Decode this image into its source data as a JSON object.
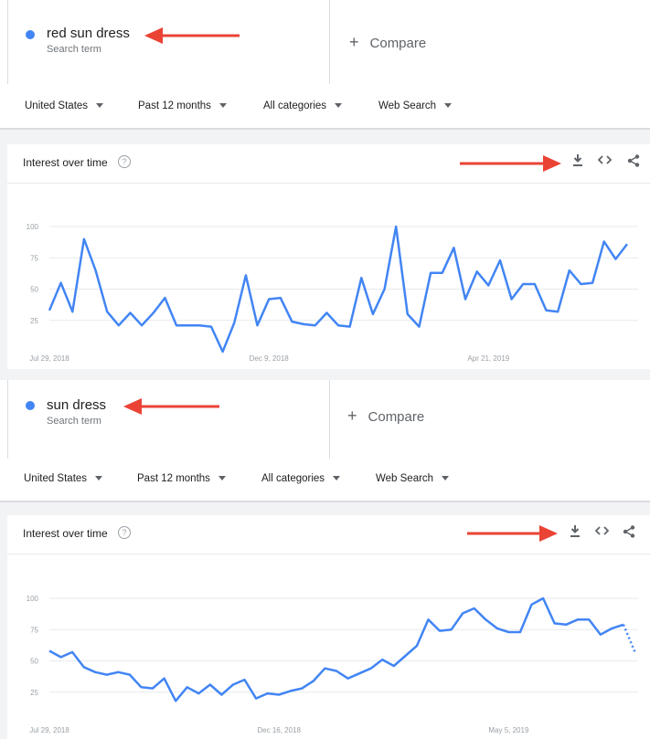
{
  "panels": [
    {
      "term": {
        "name": "red sun dress",
        "sub": "Search term"
      },
      "compare_label": "Compare",
      "filters": [
        "United States",
        "Past 12 months",
        "All categories",
        "Web Search"
      ],
      "card_title": "Interest over time",
      "help_glyph": "?",
      "icons": [
        "download-icon",
        "embed-icon",
        "share-icon"
      ],
      "chart_data": {
        "type": "line",
        "title": "Interest over time",
        "y_ticks": [
          25,
          50,
          75,
          100
        ],
        "ylim": [
          0,
          100
        ],
        "x_tick_labels": [
          "Jul 29, 2018",
          "Dec 9, 2018",
          "Apr 21, 2019"
        ],
        "x_tick_index": [
          0,
          19,
          38
        ],
        "series": [
          {
            "values": [
              33,
              55,
              32,
              90,
              65,
              32,
              21,
              31,
              21,
              31,
              43,
              21,
              21,
              21,
              20,
              0,
              23,
              61,
              21,
              42,
              43,
              24,
              22,
              21,
              31,
              21,
              20,
              59,
              30,
              50,
              100,
              30,
              20,
              63,
              63,
              83,
              42,
              64,
              53,
              73,
              42,
              54,
              54,
              33,
              32,
              65,
              54,
              55,
              88,
              74,
              86
            ],
            "color": "#4285f4"
          }
        ],
        "grid": true
      }
    },
    {
      "term": {
        "name": "sun dress",
        "sub": "Search term"
      },
      "compare_label": "Compare",
      "filters": [
        "United States",
        "Past 12 months",
        "All categories",
        "Web Search"
      ],
      "card_title": "Interest over time",
      "help_glyph": "?",
      "icons": [
        "download-icon",
        "embed-icon",
        "share-icon"
      ],
      "chart_data": {
        "type": "line",
        "title": "Interest over time",
        "y_ticks": [
          25,
          50,
          75,
          100
        ],
        "ylim": [
          0,
          100
        ],
        "x_tick_labels": [
          "Jul 29, 2018",
          "Dec 16, 2018",
          "May 5, 2019"
        ],
        "x_tick_index": [
          0,
          20,
          40
        ],
        "series": [
          {
            "values": [
              58,
              53,
              57,
              45,
              41,
              39,
              41,
              39,
              29,
              28,
              36,
              18,
              29,
              24,
              31,
              23,
              31,
              35,
              20,
              24,
              23,
              26,
              28,
              34,
              44,
              42,
              36,
              40,
              44,
              51,
              46,
              54,
              62,
              83,
              74,
              75,
              88,
              92,
              83,
              76,
              73,
              73,
              95,
              100,
              80,
              79,
              83,
              83,
              71,
              76,
              79
            ],
            "partial_values": [
              79,
              57
            ],
            "color": "#4285f4"
          }
        ],
        "grid": true
      }
    }
  ],
  "annotation": {
    "arrow_color": "#ea4335"
  }
}
